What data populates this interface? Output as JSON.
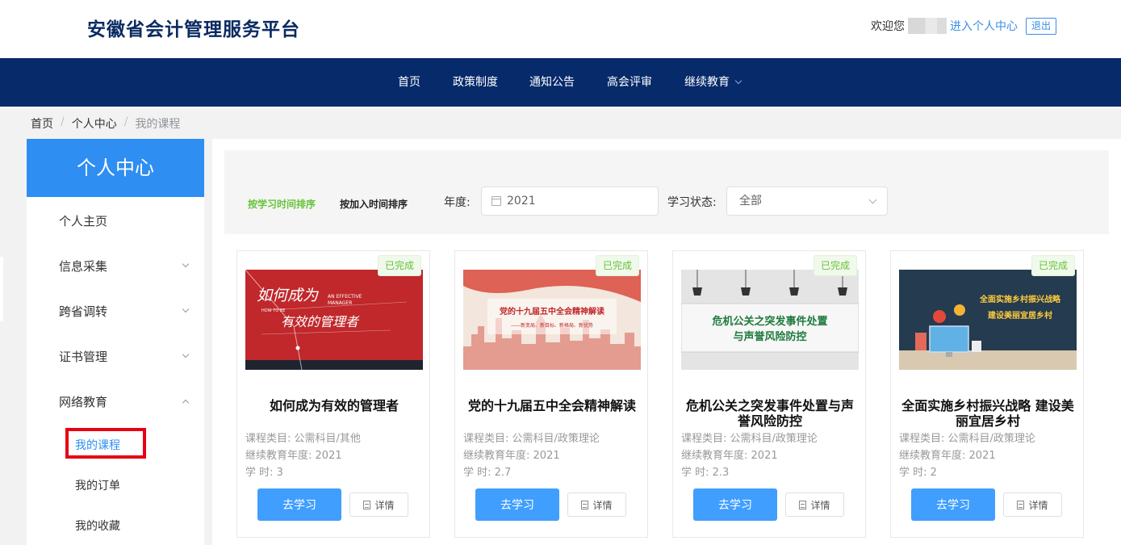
{
  "header": {
    "site_title": "安徽省会计管理服务平台",
    "welcome": "欢迎您",
    "user_center_link": "进入个人中心",
    "logout": "退出"
  },
  "nav": {
    "items": [
      "首页",
      "政策制度",
      "通知公告",
      "高会评审",
      "继续教育"
    ]
  },
  "breadcrumb": {
    "items": [
      "首页",
      "个人中心",
      "我的课程"
    ]
  },
  "sidebar": {
    "title": "个人中心",
    "items": [
      "个人主页",
      "信息采集",
      "跨省调转",
      "证书管理",
      "网络教育"
    ],
    "sub_items": [
      "我的课程",
      "我的订单",
      "我的收藏"
    ]
  },
  "filter": {
    "sort_by_study_time": "按学习时间排序",
    "sort_by_join_time": "按加入时间排序",
    "year_label": "年度:",
    "year_value": "2021",
    "status_label": "学习状态:",
    "status_value": "全部"
  },
  "course_labels": {
    "category": "课程类目:",
    "year": "继续教育年度:",
    "hours": "学 时:",
    "study_button": "去学习",
    "detail_button": "详情"
  },
  "courses": [
    {
      "status": "已完成",
      "title": "如何成为有效的管理者",
      "category": "公需科目/其他",
      "year": "2021",
      "hours": "3",
      "thumb": {
        "text1": "如何成为",
        "text2": "有效的管理者",
        "en1": "AN EFFECTIVE",
        "en2": "MANAGER",
        "en3": "HOW TO BE"
      }
    },
    {
      "status": "已完成",
      "title": "党的十九届五中全会精神解读",
      "category": "公需科目/政策理论",
      "year": "2021",
      "hours": "2.7",
      "thumb": {
        "text1": "党的十九届五中全会精神解读",
        "text2": "——新变局、新目标、新格局、新优势"
      }
    },
    {
      "status": "已完成",
      "title": "危机公关之突发事件处置与声誉风险防控",
      "category": "公需科目/政策理论",
      "year": "2021",
      "hours": "2.3",
      "thumb": {
        "text1": "危机公关之突发事件处置",
        "text2": "与声誉风险防控"
      }
    },
    {
      "status": "已完成",
      "title": "全面实施乡村振兴战略 建设美丽宜居乡村",
      "category": "公需科目/政策理论",
      "year": "2021",
      "hours": "2",
      "thumb": {
        "text1": "全面实施乡村振兴战略",
        "text2": "建设美丽宜居乡村"
      }
    }
  ],
  "colors": {
    "nav_bg": "#062a6a",
    "accent": "#2e8ef2",
    "button": "#409eff",
    "complete_green": "#67c23a",
    "highlight_red": "#e60012"
  }
}
